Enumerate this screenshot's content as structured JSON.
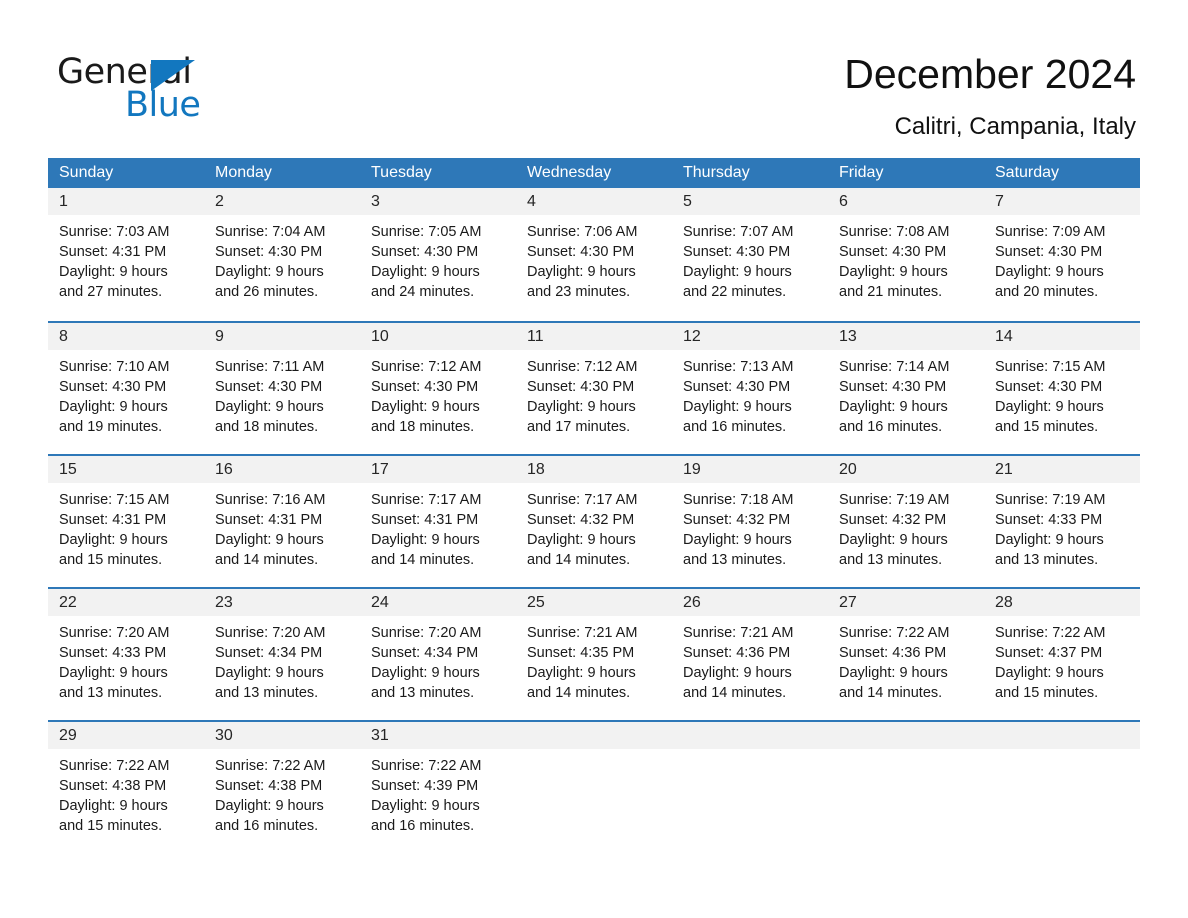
{
  "logo": {
    "text_top": "General",
    "text_bottom": "Blue",
    "triangle_icon": "triangle-icon",
    "brand_color": "#1277bf"
  },
  "header": {
    "title": "December 2024",
    "subtitle": "Calitri, Campania, Italy"
  },
  "theme": {
    "header_blue": "#2e78b8",
    "date_strip_gray": "#f2f2f2",
    "text_dark": "#1a1a1a"
  },
  "calendar": {
    "weekdays": [
      "Sunday",
      "Monday",
      "Tuesday",
      "Wednesday",
      "Thursday",
      "Friday",
      "Saturday"
    ],
    "weeks": [
      [
        {
          "date": "1",
          "sunrise": "Sunrise: 7:03 AM",
          "sunset": "Sunset: 4:31 PM",
          "daylight_1": "Daylight: 9 hours",
          "daylight_2": "and 27 minutes."
        },
        {
          "date": "2",
          "sunrise": "Sunrise: 7:04 AM",
          "sunset": "Sunset: 4:30 PM",
          "daylight_1": "Daylight: 9 hours",
          "daylight_2": "and 26 minutes."
        },
        {
          "date": "3",
          "sunrise": "Sunrise: 7:05 AM",
          "sunset": "Sunset: 4:30 PM",
          "daylight_1": "Daylight: 9 hours",
          "daylight_2": "and 24 minutes."
        },
        {
          "date": "4",
          "sunrise": "Sunrise: 7:06 AM",
          "sunset": "Sunset: 4:30 PM",
          "daylight_1": "Daylight: 9 hours",
          "daylight_2": "and 23 minutes."
        },
        {
          "date": "5",
          "sunrise": "Sunrise: 7:07 AM",
          "sunset": "Sunset: 4:30 PM",
          "daylight_1": "Daylight: 9 hours",
          "daylight_2": "and 22 minutes."
        },
        {
          "date": "6",
          "sunrise": "Sunrise: 7:08 AM",
          "sunset": "Sunset: 4:30 PM",
          "daylight_1": "Daylight: 9 hours",
          "daylight_2": "and 21 minutes."
        },
        {
          "date": "7",
          "sunrise": "Sunrise: 7:09 AM",
          "sunset": "Sunset: 4:30 PM",
          "daylight_1": "Daylight: 9 hours",
          "daylight_2": "and 20 minutes."
        }
      ],
      [
        {
          "date": "8",
          "sunrise": "Sunrise: 7:10 AM",
          "sunset": "Sunset: 4:30 PM",
          "daylight_1": "Daylight: 9 hours",
          "daylight_2": "and 19 minutes."
        },
        {
          "date": "9",
          "sunrise": "Sunrise: 7:11 AM",
          "sunset": "Sunset: 4:30 PM",
          "daylight_1": "Daylight: 9 hours",
          "daylight_2": "and 18 minutes."
        },
        {
          "date": "10",
          "sunrise": "Sunrise: 7:12 AM",
          "sunset": "Sunset: 4:30 PM",
          "daylight_1": "Daylight: 9 hours",
          "daylight_2": "and 18 minutes."
        },
        {
          "date": "11",
          "sunrise": "Sunrise: 7:12 AM",
          "sunset": "Sunset: 4:30 PM",
          "daylight_1": "Daylight: 9 hours",
          "daylight_2": "and 17 minutes."
        },
        {
          "date": "12",
          "sunrise": "Sunrise: 7:13 AM",
          "sunset": "Sunset: 4:30 PM",
          "daylight_1": "Daylight: 9 hours",
          "daylight_2": "and 16 minutes."
        },
        {
          "date": "13",
          "sunrise": "Sunrise: 7:14 AM",
          "sunset": "Sunset: 4:30 PM",
          "daylight_1": "Daylight: 9 hours",
          "daylight_2": "and 16 minutes."
        },
        {
          "date": "14",
          "sunrise": "Sunrise: 7:15 AM",
          "sunset": "Sunset: 4:30 PM",
          "daylight_1": "Daylight: 9 hours",
          "daylight_2": "and 15 minutes."
        }
      ],
      [
        {
          "date": "15",
          "sunrise": "Sunrise: 7:15 AM",
          "sunset": "Sunset: 4:31 PM",
          "daylight_1": "Daylight: 9 hours",
          "daylight_2": "and 15 minutes."
        },
        {
          "date": "16",
          "sunrise": "Sunrise: 7:16 AM",
          "sunset": "Sunset: 4:31 PM",
          "daylight_1": "Daylight: 9 hours",
          "daylight_2": "and 14 minutes."
        },
        {
          "date": "17",
          "sunrise": "Sunrise: 7:17 AM",
          "sunset": "Sunset: 4:31 PM",
          "daylight_1": "Daylight: 9 hours",
          "daylight_2": "and 14 minutes."
        },
        {
          "date": "18",
          "sunrise": "Sunrise: 7:17 AM",
          "sunset": "Sunset: 4:32 PM",
          "daylight_1": "Daylight: 9 hours",
          "daylight_2": "and 14 minutes."
        },
        {
          "date": "19",
          "sunrise": "Sunrise: 7:18 AM",
          "sunset": "Sunset: 4:32 PM",
          "daylight_1": "Daylight: 9 hours",
          "daylight_2": "and 13 minutes."
        },
        {
          "date": "20",
          "sunrise": "Sunrise: 7:19 AM",
          "sunset": "Sunset: 4:32 PM",
          "daylight_1": "Daylight: 9 hours",
          "daylight_2": "and 13 minutes."
        },
        {
          "date": "21",
          "sunrise": "Sunrise: 7:19 AM",
          "sunset": "Sunset: 4:33 PM",
          "daylight_1": "Daylight: 9 hours",
          "daylight_2": "and 13 minutes."
        }
      ],
      [
        {
          "date": "22",
          "sunrise": "Sunrise: 7:20 AM",
          "sunset": "Sunset: 4:33 PM",
          "daylight_1": "Daylight: 9 hours",
          "daylight_2": "and 13 minutes."
        },
        {
          "date": "23",
          "sunrise": "Sunrise: 7:20 AM",
          "sunset": "Sunset: 4:34 PM",
          "daylight_1": "Daylight: 9 hours",
          "daylight_2": "and 13 minutes."
        },
        {
          "date": "24",
          "sunrise": "Sunrise: 7:20 AM",
          "sunset": "Sunset: 4:34 PM",
          "daylight_1": "Daylight: 9 hours",
          "daylight_2": "and 13 minutes."
        },
        {
          "date": "25",
          "sunrise": "Sunrise: 7:21 AM",
          "sunset": "Sunset: 4:35 PM",
          "daylight_1": "Daylight: 9 hours",
          "daylight_2": "and 14 minutes."
        },
        {
          "date": "26",
          "sunrise": "Sunrise: 7:21 AM",
          "sunset": "Sunset: 4:36 PM",
          "daylight_1": "Daylight: 9 hours",
          "daylight_2": "and 14 minutes."
        },
        {
          "date": "27",
          "sunrise": "Sunrise: 7:22 AM",
          "sunset": "Sunset: 4:36 PM",
          "daylight_1": "Daylight: 9 hours",
          "daylight_2": "and 14 minutes."
        },
        {
          "date": "28",
          "sunrise": "Sunrise: 7:22 AM",
          "sunset": "Sunset: 4:37 PM",
          "daylight_1": "Daylight: 9 hours",
          "daylight_2": "and 15 minutes."
        }
      ],
      [
        {
          "date": "29",
          "sunrise": "Sunrise: 7:22 AM",
          "sunset": "Sunset: 4:38 PM",
          "daylight_1": "Daylight: 9 hours",
          "daylight_2": "and 15 minutes."
        },
        {
          "date": "30",
          "sunrise": "Sunrise: 7:22 AM",
          "sunset": "Sunset: 4:38 PM",
          "daylight_1": "Daylight: 9 hours",
          "daylight_2": "and 16 minutes."
        },
        {
          "date": "31",
          "sunrise": "Sunrise: 7:22 AM",
          "sunset": "Sunset: 4:39 PM",
          "daylight_1": "Daylight: 9 hours",
          "daylight_2": "and 16 minutes."
        },
        {
          "date": "",
          "sunrise": "",
          "sunset": "",
          "daylight_1": "",
          "daylight_2": ""
        },
        {
          "date": "",
          "sunrise": "",
          "sunset": "",
          "daylight_1": "",
          "daylight_2": ""
        },
        {
          "date": "",
          "sunrise": "",
          "sunset": "",
          "daylight_1": "",
          "daylight_2": ""
        },
        {
          "date": "",
          "sunrise": "",
          "sunset": "",
          "daylight_1": "",
          "daylight_2": ""
        }
      ]
    ]
  }
}
